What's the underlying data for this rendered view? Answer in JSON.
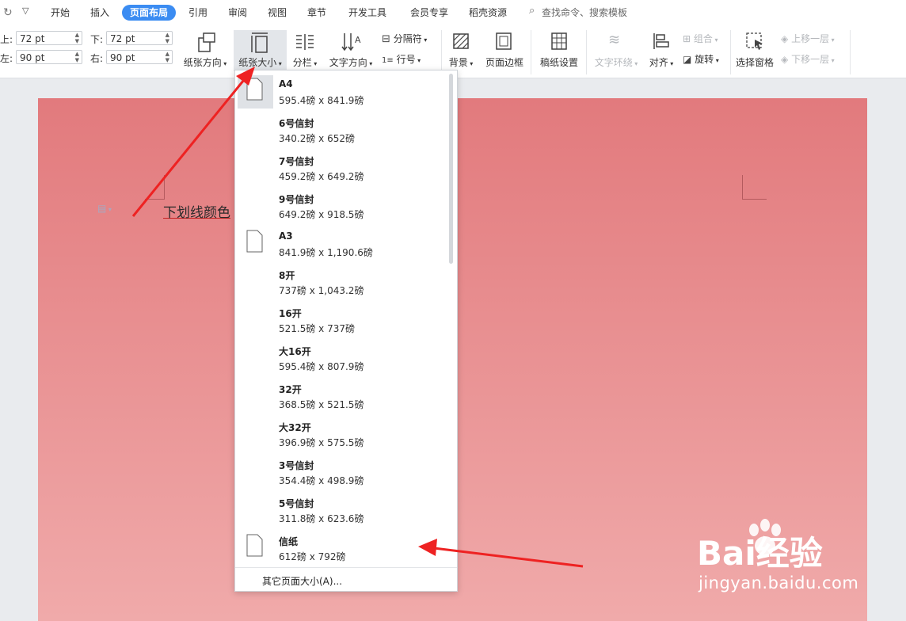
{
  "tabs": [
    "开始",
    "插入",
    "页面布局",
    "引用",
    "审阅",
    "视图",
    "章节",
    "开发工具",
    "会员专享",
    "稻壳资源"
  ],
  "search_placeholder": "查找命令、搜索模板",
  "margins": {
    "top_label": "上:",
    "top_value": "72 pt",
    "bottom_label": "下:",
    "bottom_value": "72 pt",
    "left_label": "左:",
    "left_value": "90 pt",
    "right_label": "右:",
    "right_value": "90 pt"
  },
  "toolbar": {
    "orientation": "纸张方向",
    "size": "纸张大小",
    "columns": "分栏",
    "text_direction": "文字方向",
    "separator": "分隔符",
    "line_number": "行号",
    "background": "背景",
    "page_border": "页面边框",
    "manuscript": "稿纸设置",
    "text_wrap": "文字环绕",
    "align": "对齐",
    "group": "组合",
    "rotate": "旋转",
    "selection_pane": "选择窗格",
    "bring_forward": "上移一层",
    "send_backward": "下移一层"
  },
  "document_text": "下划线颜色",
  "paper_sizes": [
    {
      "name": "A4",
      "dims": "595.4磅 x 841.9磅"
    },
    {
      "name": "6号信封",
      "dims": "340.2磅 x 652磅"
    },
    {
      "name": "7号信封",
      "dims": "459.2磅 x 649.2磅"
    },
    {
      "name": "9号信封",
      "dims": "649.2磅 x 918.5磅"
    },
    {
      "name": "A3",
      "dims": "841.9磅 x 1,190.6磅"
    },
    {
      "name": "8开",
      "dims": "737磅 x 1,043.2磅"
    },
    {
      "name": "16开",
      "dims": "521.5磅 x 737磅"
    },
    {
      "name": "大16开",
      "dims": "595.4磅 x 807.9磅"
    },
    {
      "name": "32开",
      "dims": "368.5磅 x 521.5磅"
    },
    {
      "name": "大32开",
      "dims": "396.9磅 x 575.5磅"
    },
    {
      "name": "3号信封",
      "dims": "354.4磅 x 498.9磅"
    },
    {
      "name": "5号信封",
      "dims": "311.8磅 x 623.6磅"
    },
    {
      "name": "信纸",
      "dims": "612磅 x 792磅"
    }
  ],
  "more_sizes": "其它页面大小(A)...",
  "watermark": {
    "brand": "Bai经验",
    "url": "jingyan.baidu.com"
  },
  "colors": {
    "accent": "#3b8cf2",
    "page_bg": "#e98a8c",
    "arrow": "#ee2222"
  }
}
